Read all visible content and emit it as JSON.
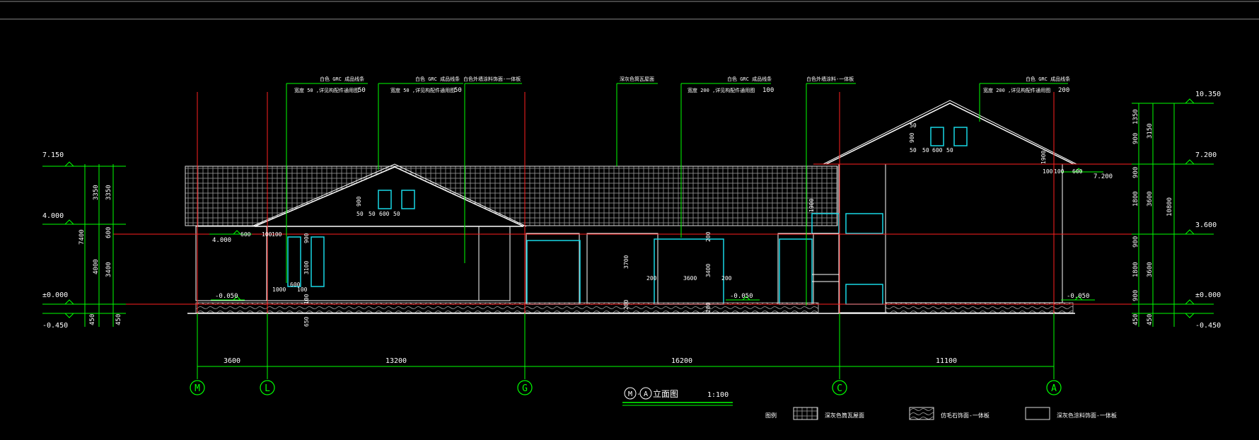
{
  "colors": {
    "background": "#000000",
    "building": "#ffffff",
    "dimension": "#00ff00",
    "axis": "#ff2020",
    "glazing": "#19d7e6",
    "roof_tile": "#bdbdbd"
  },
  "title": {
    "label": "M-A立面图",
    "circle_start": "M",
    "circle_end": "A",
    "suffix": "立面图",
    "scale": "1:100"
  },
  "grid_bubbles": [
    "M",
    "L",
    "G",
    "C",
    "A"
  ],
  "horizontal_dims": [
    "3600",
    "13200",
    "16200",
    "11100"
  ],
  "left_levels": [
    "7.150",
    "4.000",
    "±0.000",
    "-0.450"
  ],
  "left_dims": {
    "d3350a": "3350",
    "d3350b": "3350",
    "d600": "600",
    "d4000": "4000",
    "d3400": "3400",
    "d7400": "7400",
    "d450a": "450",
    "d450b": "450"
  },
  "right_levels": [
    "10.350",
    "7.200",
    "3.600",
    "±0.000",
    "-0.450"
  ],
  "right_dims": {
    "r1350": "1350",
    "r3150": "3150",
    "r900a": "900",
    "r900b": "900",
    "r1800a": "1800",
    "r3600a": "3600",
    "r900c": "900",
    "r1800b": "1800",
    "r3600b": "3600",
    "r900d": "900",
    "r10800": "10800",
    "r450a": "450",
    "r450b": "450"
  },
  "elevation_marks": {
    "left_4000": "4.000",
    "left_m0050": "-0.050",
    "mid_m0050": "-0.050",
    "right_m0050": "-0.050",
    "right_7200": "7.200"
  },
  "annotations": {
    "grc1": "白色 GRC 成品线条",
    "grc1_sub": "宽度 50 ,详见构配件通用图",
    "grc1_num": "50",
    "grc2": "白色 GRC 成品线条",
    "grc2_sub": "宽度 50 ,详见构配件通用图",
    "grc2_num": "50",
    "paint1": "白色外墙涂料饰面-一体板",
    "roof": "深灰色筒瓦屋面",
    "grc3": "白色 GRC 成品线条",
    "grc3_sub": "宽度 200 ,详见构配件通用图",
    "grc3_num": "100",
    "paint2": "白色外墙涂料-一体板",
    "grc4": "白色 GRC 成品线条",
    "grc4_sub": "宽度 200 ,详见构配件通用图",
    "grc4_num": "200"
  },
  "window_dims": {
    "l_50a": "50",
    "l_900": "900",
    "l_50b": "50",
    "l_600": "600",
    "l_50c": "50",
    "l_600b": "600",
    "l_100a": "100",
    "l_100b": "100",
    "l_1000": "1000",
    "l_100c": "100",
    "l_600c": "600",
    "l_900b": "900",
    "l_3100": "3100",
    "l_100d": "100",
    "l_650": "650",
    "m_3700": "3700",
    "m_200a": "200",
    "m_3600": "3600",
    "m_200b": "200",
    "m_200c": "200",
    "m_3400": "3400",
    "m_200d": "200",
    "m_200e": "200",
    "m_1900": "1900",
    "r_50a": "50",
    "r_900": "900",
    "r_50b": "50",
    "r_50c": "50",
    "r_600": "600",
    "r_50d": "50",
    "r_100a": "100",
    "r_100b": "100",
    "r_600b": "600",
    "r_1900": "1900"
  },
  "legend": {
    "label": "图例",
    "item1": "深灰色筒瓦屋面",
    "item2": "仿毛石饰面-一体板",
    "item3": "深灰色涂料饰面-一体板"
  }
}
